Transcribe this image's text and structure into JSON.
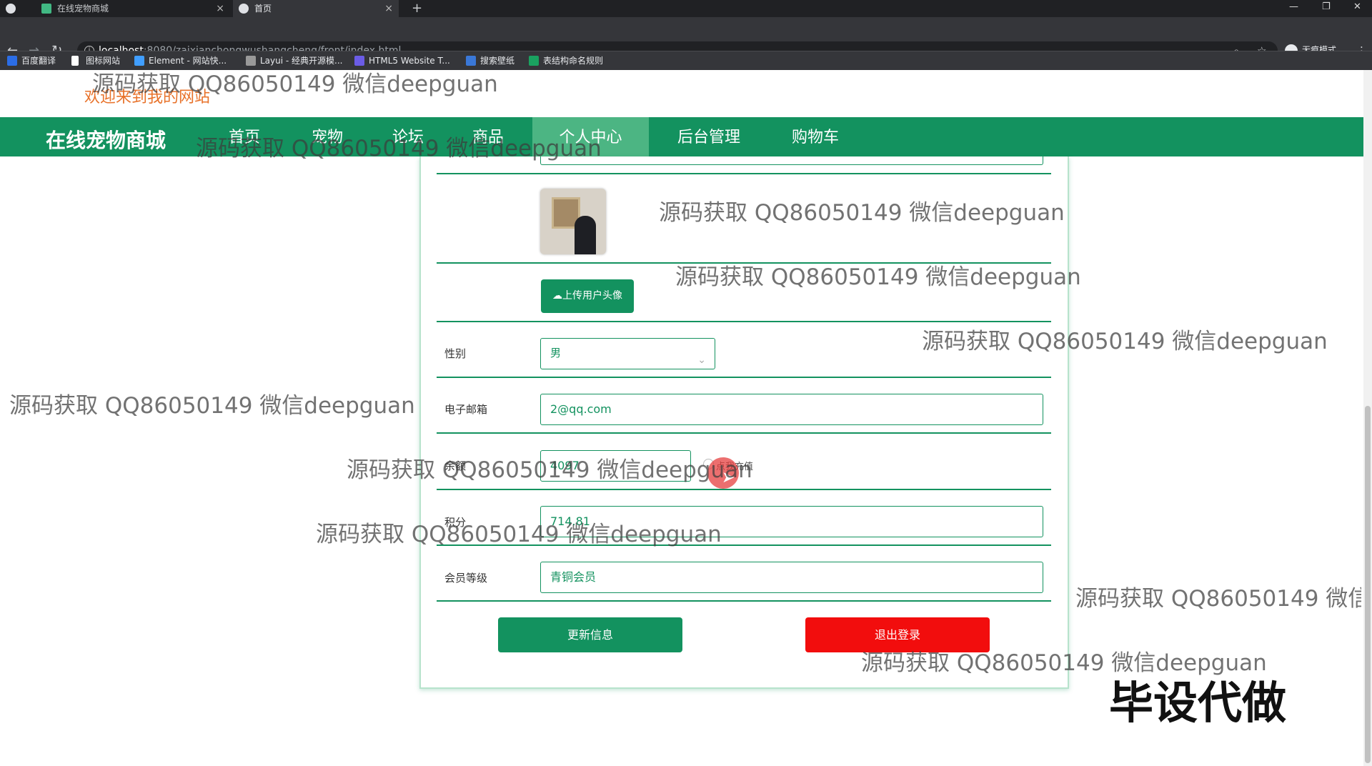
{
  "browser": {
    "tabs": [
      {
        "label": "在线宠物商城"
      },
      {
        "label": "首页"
      }
    ],
    "new_tab": "+",
    "url_host": "localhost",
    "url_path": ":8080/zaixianchongwushangcheng/front/index.html",
    "incognito_label": "无痕模式",
    "bookmarks": [
      {
        "label": "百度翻译",
        "color": "#2b6de6"
      },
      {
        "label": "图标网站",
        "color": "#ffffff"
      },
      {
        "label": "Element - 网站快...",
        "color": "#409eff"
      },
      {
        "label": "Layui - 经典开源模...",
        "color": "#999999"
      },
      {
        "label": "HTML5 Website T...",
        "color": "#6b5ce6"
      },
      {
        "label": "搜索壁纸",
        "color": "#3a78d8"
      },
      {
        "label": "表结构命名规则",
        "color": "#1aa260"
      }
    ]
  },
  "site": {
    "welcome": "欢迎来到我的网站",
    "brand": "在线宠物商城",
    "nav": [
      "首页",
      "宠物",
      "论坛",
      "商品",
      "个人中心",
      "后台管理",
      "购物车"
    ],
    "active_nav": "个人中心"
  },
  "form": {
    "upload_label": "上传用户头像",
    "gender_label": "性别",
    "gender_value": "男",
    "email_label": "电子邮箱",
    "email_value": "2@qq.com",
    "balance_label": "余额",
    "balance_value": "4097",
    "recharge_label": "点我充值",
    "points_label": "积分",
    "points_value": "714.81",
    "level_label": "会员等级",
    "level_value": "青铜会员",
    "update_button": "更新信息",
    "logout_button": "退出登录"
  },
  "watermark": "源码获取 QQ86050149 微信deepguan",
  "corner_text": "毕设代做",
  "colors": {
    "primary": "#13925f",
    "nav_active": "#4cb583",
    "danger": "#f20d0d",
    "welcome": "#e8722a"
  }
}
